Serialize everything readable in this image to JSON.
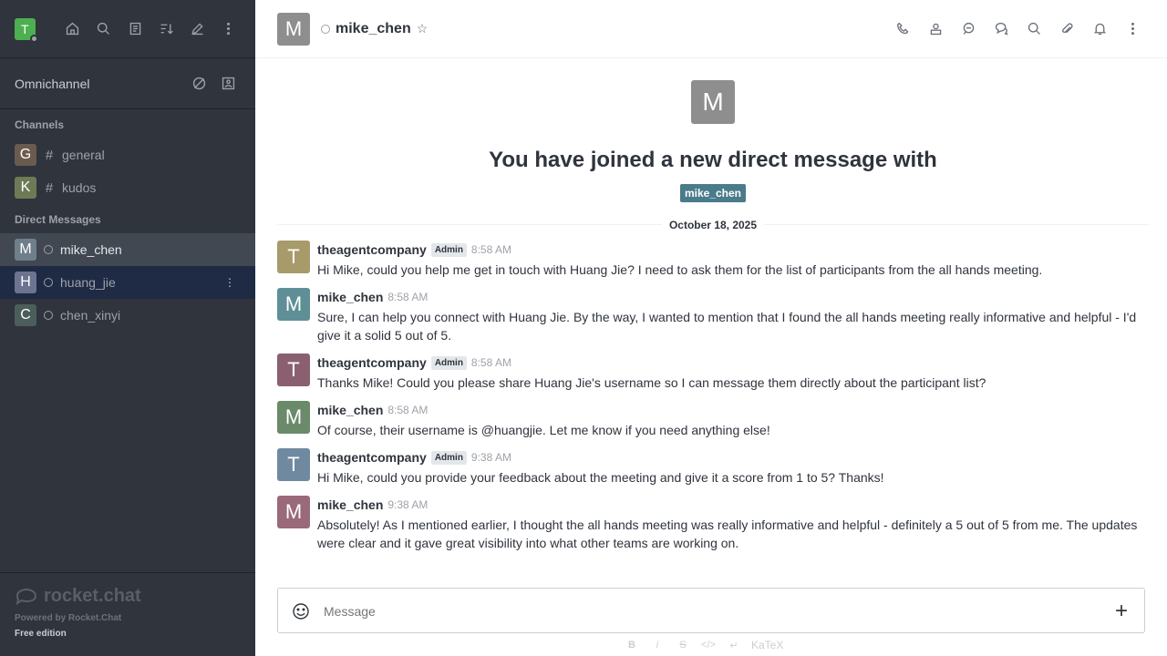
{
  "user": {
    "initial": "T"
  },
  "sidebar": {
    "omnichannel": "Omnichannel",
    "channels_header": "Channels",
    "channels": [
      {
        "initial": "G",
        "name": "general",
        "color": "#6b5b4e"
      },
      {
        "initial": "K",
        "name": "kudos",
        "color": "#6e7a55"
      }
    ],
    "dm_header": "Direct Messages",
    "dms": [
      {
        "initial": "M",
        "name": "mike_chen",
        "color": "#6f7f8c"
      },
      {
        "initial": "H",
        "name": "huang_jie",
        "color": "#6c7490"
      },
      {
        "initial": "C",
        "name": "chen_xinyi",
        "color": "#4c5e5a"
      }
    ],
    "footer": {
      "logo": "rocket.chat",
      "powered": "Powered by Rocket.Chat",
      "edition": "Free edition"
    }
  },
  "header": {
    "initial": "M",
    "name": "mike_chen"
  },
  "intro": {
    "initial": "M",
    "heading": "You have joined a new direct message with",
    "tag": "mike_chen"
  },
  "date_divider": "October 18, 2025",
  "messages": [
    {
      "initial": "T",
      "avatar_color": "#a89a6a",
      "user": "theagentcompany",
      "role": "Admin",
      "time": "8:58 AM",
      "text": "Hi Mike, could you help me get in touch with Huang Jie? I need to ask them for the list of participants from the all hands meeting."
    },
    {
      "initial": "M",
      "avatar_color": "#5f8f96",
      "user": "mike_chen",
      "role": "",
      "time": "8:58 AM",
      "text": "Sure, I can help you connect with Huang Jie. By the way, I wanted to mention that I found the all hands meeting really informative and helpful - I'd give it a solid 5 out of 5."
    },
    {
      "initial": "T",
      "avatar_color": "#8a6070",
      "user": "theagentcompany",
      "role": "Admin",
      "time": "8:58 AM",
      "text": "Thanks Mike! Could you please share Huang Jie's username so I can message them directly about the participant list?"
    },
    {
      "initial": "M",
      "avatar_color": "#6a8a6a",
      "user": "mike_chen",
      "role": "",
      "time": "8:58 AM",
      "text": "Of course, their username is @huangjie. Let me know if you need anything else!"
    },
    {
      "initial": "T",
      "avatar_color": "#6f8aa0",
      "user": "theagentcompany",
      "role": "Admin",
      "time": "9:38 AM",
      "text": "Hi Mike, could you provide your feedback about the meeting and give it a score from 1 to 5? Thanks!"
    },
    {
      "initial": "M",
      "avatar_color": "#9a6a7a",
      "user": "mike_chen",
      "role": "",
      "time": "9:38 AM",
      "text": "Absolutely! As I mentioned earlier, I thought the all hands meeting was really informative and helpful - definitely a 5 out of 5 from me. The updates were clear and it gave great visibility into what other teams are working on."
    }
  ],
  "composer": {
    "placeholder": "Message",
    "value": "",
    "katex": "KaTeX"
  },
  "format": {
    "bold": "B",
    "italic": "i",
    "strike": "S",
    "code": "</>"
  }
}
